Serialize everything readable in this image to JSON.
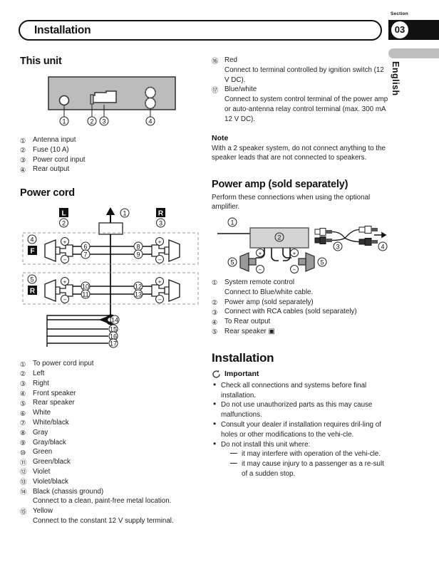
{
  "header": {
    "title": "Installation",
    "section_label": "Section",
    "section_number": "03",
    "language_tab": "English"
  },
  "left_column": {
    "this_unit": {
      "heading": "This unit",
      "diagram_callouts": [
        "1",
        "2",
        "3",
        "4"
      ],
      "items": [
        {
          "num": "①",
          "text": "Antenna input"
        },
        {
          "num": "②",
          "text": "Fuse (10 A)"
        },
        {
          "num": "③",
          "text": "Power cord input"
        },
        {
          "num": "④",
          "text": "Rear output"
        }
      ]
    },
    "power_cord": {
      "heading": "Power cord",
      "badges": {
        "left": "L",
        "right": "R",
        "front": "F",
        "rear": "R"
      },
      "items": [
        {
          "num": "①",
          "text": "To power cord input"
        },
        {
          "num": "②",
          "text": "Left"
        },
        {
          "num": "③",
          "text": "Right"
        },
        {
          "num": "④",
          "text": "Front speaker"
        },
        {
          "num": "⑤",
          "text": "Rear speaker"
        },
        {
          "num": "⑥",
          "text": "White"
        },
        {
          "num": "⑦",
          "text": "White/black"
        },
        {
          "num": "⑧",
          "text": "Gray"
        },
        {
          "num": "⑨",
          "text": "Gray/black"
        },
        {
          "num": "⑩",
          "text": "Green"
        },
        {
          "num": "⑪",
          "text": "Green/black"
        },
        {
          "num": "⑫",
          "text": "Violet"
        },
        {
          "num": "⑬",
          "text": "Violet/black"
        },
        {
          "num": "⑭",
          "text": "Black (chassis ground)",
          "sub": "Connect to a clean, paint-free metal location."
        },
        {
          "num": "⑮",
          "text": "Yellow",
          "sub": "Connect to the constant 12 V supply terminal."
        }
      ]
    }
  },
  "right_column": {
    "continued_items": [
      {
        "num": "⑯",
        "text": "Red",
        "sub": "Connect to terminal controlled by ignition switch (12 V DC)."
      },
      {
        "num": "⑰",
        "text": "Blue/white",
        "sub": "Connect to system control terminal of the power amp or auto-antenna relay control terminal (max. 300 mA 12 V DC)."
      }
    ],
    "note": {
      "heading": "Note",
      "text": "With a 2 speaker system, do not connect anything to the speaker leads that are not connected to speakers."
    },
    "power_amp": {
      "heading": "Power amp (sold separately)",
      "intro": "Perform these connections when using the optional amplifier.",
      "items": [
        {
          "num": "①",
          "text": "System remote control",
          "sub": "Connect to Blue/white cable."
        },
        {
          "num": "②",
          "text": "Power amp (sold separately)"
        },
        {
          "num": "③",
          "text": "Connect with RCA cables (sold separately)"
        },
        {
          "num": "④",
          "text": "To Rear output"
        },
        {
          "num": "⑤",
          "text": "Rear speaker ▣"
        }
      ]
    },
    "installation": {
      "heading": "Installation",
      "important_label": "Important",
      "important_icon": "circular-arrow-icon",
      "bullets": [
        {
          "text": "Check all connections and systems before final installation."
        },
        {
          "text": "Do not use unauthorized parts as this may cause malfunctions."
        },
        {
          "text": "Consult your dealer if installation requires dril-ling of holes or other modifications to the vehi-cle."
        },
        {
          "text": "Do not install this unit where:",
          "dashes": [
            "it may interfere with operation of the vehi-cle.",
            "it may cause injury to a passenger as a re-sult of a sudden stop."
          ]
        }
      ]
    }
  },
  "colors": {
    "unit_body": "#bcbcbc",
    "amp_body": "#d4d4d4",
    "tab_black": "#111111",
    "lang_tab_gray": "#bfbfbf"
  }
}
